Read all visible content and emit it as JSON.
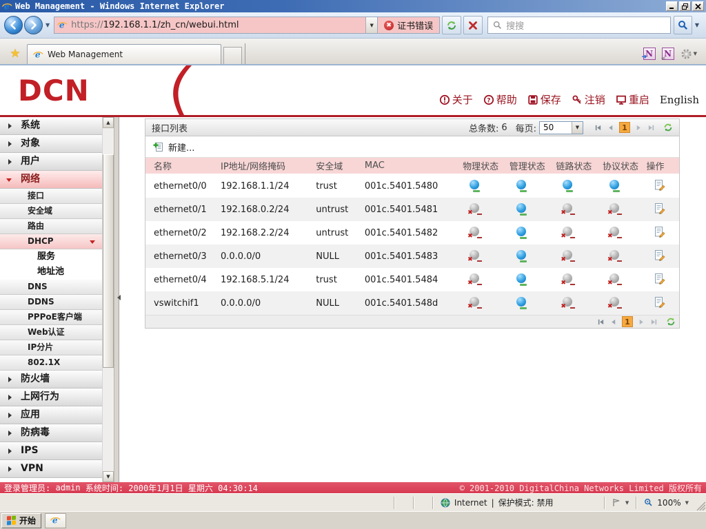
{
  "window": {
    "title": "Web Management - Windows Internet Explorer"
  },
  "nav": {
    "url": "https://192.168.1.1/zh_cn/webui.html",
    "cert_error": "证书错误",
    "search_placeholder": "搜搜"
  },
  "tab": {
    "label": "Web Management"
  },
  "header": {
    "logo": "DCN",
    "links": [
      {
        "id": "about",
        "label": "关于",
        "icon": "about-icon"
      },
      {
        "id": "help",
        "label": "帮助",
        "icon": "help-icon"
      },
      {
        "id": "save",
        "label": "保存",
        "icon": "save-icon"
      },
      {
        "id": "logout",
        "label": "注销",
        "icon": "logout-icon"
      },
      {
        "id": "restart",
        "label": "重启",
        "icon": "restart-icon"
      },
      {
        "id": "english",
        "label": "English"
      }
    ]
  },
  "sidebar": {
    "items": [
      {
        "id": "system",
        "label": "系统",
        "level": 1,
        "state": "collapsed"
      },
      {
        "id": "object",
        "label": "对象",
        "level": 1,
        "state": "collapsed"
      },
      {
        "id": "user",
        "label": "用户",
        "level": 1,
        "state": "collapsed"
      },
      {
        "id": "network",
        "label": "网络",
        "level": 1,
        "state": "expanded",
        "selected": true
      },
      {
        "id": "interface",
        "label": "接口",
        "level": 2
      },
      {
        "id": "security-zone",
        "label": "安全域",
        "level": 2
      },
      {
        "id": "route",
        "label": "路由",
        "level": 2
      },
      {
        "id": "dhcp",
        "label": "DHCP",
        "level": 2,
        "state": "expanded",
        "selected": true
      },
      {
        "id": "dhcp-service",
        "label": "服务",
        "level": 3
      },
      {
        "id": "dhcp-pool",
        "label": "地址池",
        "level": 3
      },
      {
        "id": "dns",
        "label": "DNS",
        "level": 2
      },
      {
        "id": "ddns",
        "label": "DDNS",
        "level": 2
      },
      {
        "id": "pppoe-client",
        "label": "PPPoE客户端",
        "level": 2
      },
      {
        "id": "web-auth",
        "label": "Web认证",
        "level": 2
      },
      {
        "id": "ip-frag",
        "label": "IP分片",
        "level": 2
      },
      {
        "id": "dot1x",
        "label": "802.1X",
        "level": 2
      },
      {
        "id": "firewall",
        "label": "防火墙",
        "level": 1,
        "state": "collapsed"
      },
      {
        "id": "net-behavior",
        "label": "上网行为",
        "level": 1,
        "state": "collapsed"
      },
      {
        "id": "application",
        "label": "应用",
        "level": 1,
        "state": "collapsed"
      },
      {
        "id": "antivirus",
        "label": "防病毒",
        "level": 1,
        "state": "collapsed"
      },
      {
        "id": "ips",
        "label": "IPS",
        "level": 1,
        "state": "collapsed"
      },
      {
        "id": "vpn",
        "label": "VPN",
        "level": 1,
        "state": "collapsed"
      }
    ]
  },
  "main": {
    "panel_title": "接口列表",
    "total_label": "总条数:",
    "total": "6",
    "per_page_label": "每页:",
    "per_page": "50",
    "page": "1",
    "new_label": "新建...",
    "table": {
      "headers": [
        "名称",
        "IP地址/网络掩码",
        "安全域",
        "MAC",
        "物理状态",
        "管理状态",
        "链路状态",
        "协议状态",
        "操作"
      ],
      "rows": [
        {
          "name": "ethernet0/0",
          "ip": "192.168.1.1/24",
          "zone": "trust",
          "mac": "001c.5401.5480",
          "physical": "up",
          "admin": "up",
          "link": "up",
          "protocol": "up"
        },
        {
          "name": "ethernet0/1",
          "ip": "192.168.0.2/24",
          "zone": "untrust",
          "mac": "001c.5401.5481",
          "physical": "down",
          "admin": "up",
          "link": "down",
          "protocol": "down"
        },
        {
          "name": "ethernet0/2",
          "ip": "192.168.2.2/24",
          "zone": "untrust",
          "mac": "001c.5401.5482",
          "physical": "down",
          "admin": "up",
          "link": "down",
          "protocol": "down"
        },
        {
          "name": "ethernet0/3",
          "ip": "0.0.0.0/0",
          "zone": "NULL",
          "mac": "001c.5401.5483",
          "physical": "down",
          "admin": "up",
          "link": "down",
          "protocol": "down"
        },
        {
          "name": "ethernet0/4",
          "ip": "192.168.5.1/24",
          "zone": "trust",
          "mac": "001c.5401.5484",
          "physical": "down",
          "admin": "up",
          "link": "down",
          "protocol": "down"
        },
        {
          "name": "vswitchif1",
          "ip": "0.0.0.0/0",
          "zone": "NULL",
          "mac": "001c.5401.548d",
          "physical": "down",
          "admin": "up",
          "link": "down",
          "protocol": "down"
        }
      ]
    }
  },
  "footer": {
    "admin_label": "登录管理员:",
    "admin": "admin",
    "time_label": "系统时间:",
    "time": "2000年1月1日 星期六 04:30:14",
    "copyright": "© 2001-2010 DigitalChina Networks Limited 版权所有"
  },
  "statusbar": {
    "zone": "Internet",
    "divider": "|",
    "protected_mode": "保护模式: 禁用",
    "zoom": "100%"
  },
  "taskbar": {
    "start": "开始"
  },
  "colors": {
    "brand_red": "#c21f26",
    "table_header_pink": "#f8d6d6",
    "status_up_blue": "#2f9fe0",
    "status_down_gray": "#9e9e9e",
    "cert_error_pink": "#f6c6c6",
    "page_current_orange": "#f5a93f"
  }
}
